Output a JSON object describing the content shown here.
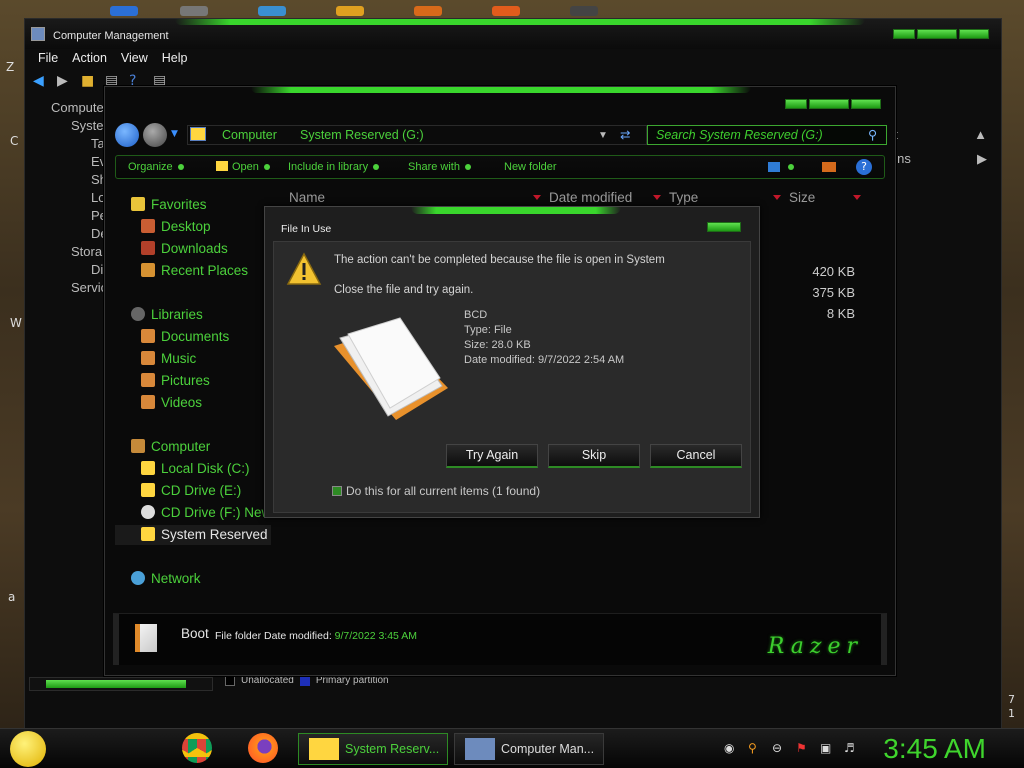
{
  "desktop": {
    "side_letters": [
      "Z",
      "C",
      "W",
      "a"
    ]
  },
  "computer_management": {
    "title": "Computer Management",
    "menu": [
      "File",
      "Action",
      "View",
      "Help"
    ],
    "tree": [
      "Compute",
      "Syste",
      "Ta",
      "Ev",
      "Sh",
      "Lo",
      "Pe",
      "De",
      "Stora",
      "Di",
      "Servic"
    ],
    "right_pane": [
      "nt",
      "ions"
    ],
    "legend": {
      "unallocated": "Unallocated",
      "primary": "Primary partition"
    },
    "scroll_nums": [
      "7",
      "1"
    ]
  },
  "explorer": {
    "breadcrumb": [
      "Computer",
      "System Reserved (G:)"
    ],
    "search_placeholder": "Search System Reserved (G:)",
    "commands": [
      "Organize",
      "Open",
      "Include in library",
      "Share with",
      "New folder"
    ],
    "columns": [
      "Name",
      "Date modified",
      "Type",
      "Size"
    ],
    "sizes": [
      "420 KB",
      "375 KB",
      "8 KB"
    ],
    "nav": {
      "favorites": "Favorites",
      "desktop": "Desktop",
      "downloads": "Downloads",
      "recent": "Recent Places",
      "libraries": "Libraries",
      "documents": "Documents",
      "music": "Music",
      "pictures": "Pictures",
      "videos": "Videos",
      "computer": "Computer",
      "local_disk": "Local Disk (C:)",
      "cd_e": "CD Drive (E:)",
      "cd_f": "CD Drive (F:) New",
      "system_reserved": "System Reserved",
      "network": "Network"
    },
    "details": {
      "name": "Boot",
      "type": "File folder",
      "date_label": "Date modified:",
      "date_value": "9/7/2022 3:45 AM"
    },
    "brand": "Razer"
  },
  "dialog": {
    "title": "File In Use",
    "message": "The action can't be completed because the file is open in System",
    "hint": "Close the file and try again.",
    "file": {
      "name": "BCD",
      "type": "Type: File",
      "size": "Size: 28.0 KB",
      "modified": "Date modified: 9/7/2022 2:54 AM"
    },
    "buttons": {
      "try_again": "Try Again",
      "skip": "Skip",
      "cancel": "Cancel"
    },
    "checkbox": "Do this for all current items (1 found)"
  },
  "taskbar": {
    "items": [
      "System Reserv...",
      "Computer Man..."
    ],
    "clock": "3:45 AM"
  }
}
